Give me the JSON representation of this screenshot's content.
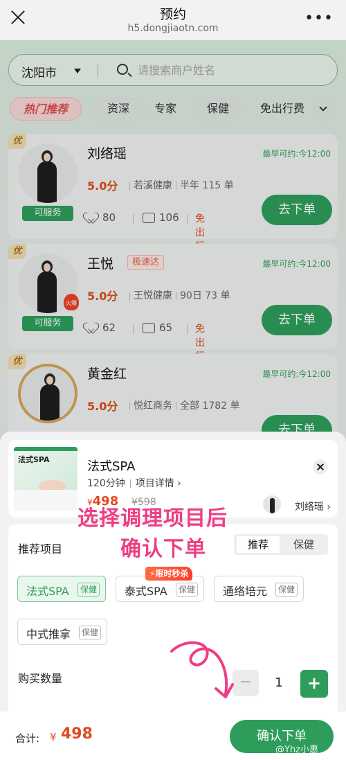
{
  "topbar": {
    "title": "预约",
    "url": "h5.dongjiaotn.com"
  },
  "search": {
    "city": "沈阳市",
    "placeholder": "请搜索商户姓名"
  },
  "filters": [
    "热门推荐",
    "资深",
    "专家",
    "保健",
    "免出行费"
  ],
  "cards": [
    {
      "badge": "优",
      "name": "刘络瑶",
      "fast": "",
      "earliest": "最早可约:今12:00",
      "score": "5.0分",
      "shop": "若溪健康",
      "period": "半年 115 单",
      "likes": "80",
      "comments": "106",
      "free": "免出行费",
      "serve": "可服务",
      "order": "去下单"
    },
    {
      "badge": "优",
      "name": "王悦",
      "fast": "极速达",
      "earliest": "最早可约:今12:00",
      "score": "5.0分",
      "shop": "王悦健康",
      "period": "90日 73 单",
      "likes": "62",
      "comments": "65",
      "free": "免出行费",
      "serve": "可服务",
      "order": "去下单",
      "fire": "火爆"
    },
    {
      "badge": "优",
      "name": "黄金红",
      "fast": "",
      "earliest": "最早可约:今12:00",
      "score": "5.0分",
      "shop": "悦红商务",
      "period": "全部 1782 单",
      "order": "去下单"
    }
  ],
  "product": {
    "name": "法式SPA",
    "duration": "120分钟",
    "detail": "项目详情 ›",
    "currency": "¥",
    "price": "498",
    "original": "¥598",
    "thumb_title": "法式SPA",
    "technician": "刘络瑶 ›"
  },
  "annotation": {
    "line1": "选择调理项目后",
    "line2": "确认下单"
  },
  "options": {
    "section": "推荐项目",
    "tabs": [
      "推荐",
      "保健"
    ],
    "items": [
      {
        "label": "法式SPA",
        "tag": "保健",
        "selected": true
      },
      {
        "label": "泰式SPA",
        "tag": "保健",
        "flash": "⚡限时秒杀"
      },
      {
        "label": "通络培元",
        "tag": "保健"
      },
      {
        "label": "中式推拿",
        "tag": "保健"
      }
    ]
  },
  "quantity": {
    "label": "购买数量",
    "value": "1",
    "minus": "−",
    "plus": "+"
  },
  "footer": {
    "total_label": "合计:",
    "currency": "¥",
    "total": "498",
    "confirm": "确认下单",
    "watermark": "@Yhz小惠"
  },
  "colors": {
    "brand_green": "#2e9d5c",
    "price_red": "#e04a1e",
    "annotation_pink": "#ee3e86"
  }
}
